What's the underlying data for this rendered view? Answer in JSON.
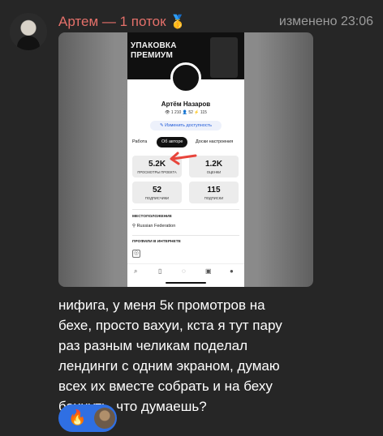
{
  "sender": {
    "name": "Артем — 1 поток",
    "medal": "🥇"
  },
  "timestamp": "изменено 23:06",
  "screenshot": {
    "banner_text": "УПАКОВКА\nПРЕМИУМ",
    "profile_name": "Артём Назаров",
    "profile_stats": "👁 1 210  👤 52  ⚡ 115",
    "edit_button": "✎ Изменить доступность",
    "tabs": [
      "Работа",
      "Об авторе",
      "Доски настроения"
    ],
    "stats": [
      {
        "value": "5.2K",
        "label": "ПРОСМОТРЫ ПРОЕКТА"
      },
      {
        "value": "1.2K",
        "label": "ОЦЕНКИ"
      },
      {
        "value": "52",
        "label": "ПОДПИСЧИКИ"
      },
      {
        "value": "115",
        "label": "ПОДПИСКИ"
      }
    ],
    "location_title": "МЕСТОПОЛОЖЕНИЕ",
    "location_value": "Russian Federation",
    "profiles_title": "ПРОФИЛИ В ИНТЕРНЕТЕ",
    "accent_arrow_color": "#e8453c"
  },
  "message_text": "нифига, у меня 5к промотров на\nбехе, просто вахуи, кста я тут пару\nраз разным челикам поделал\nлендинги с одним экраном, думаю\nвсех их вместе собрать и на беху\nбахнуть, что думаешь?",
  "reaction": {
    "emoji": "🔥",
    "color": "#2f6fe3"
  },
  "colors": {
    "background": "#262626",
    "sender": "#e4706a",
    "time": "#9c9c9c"
  }
}
